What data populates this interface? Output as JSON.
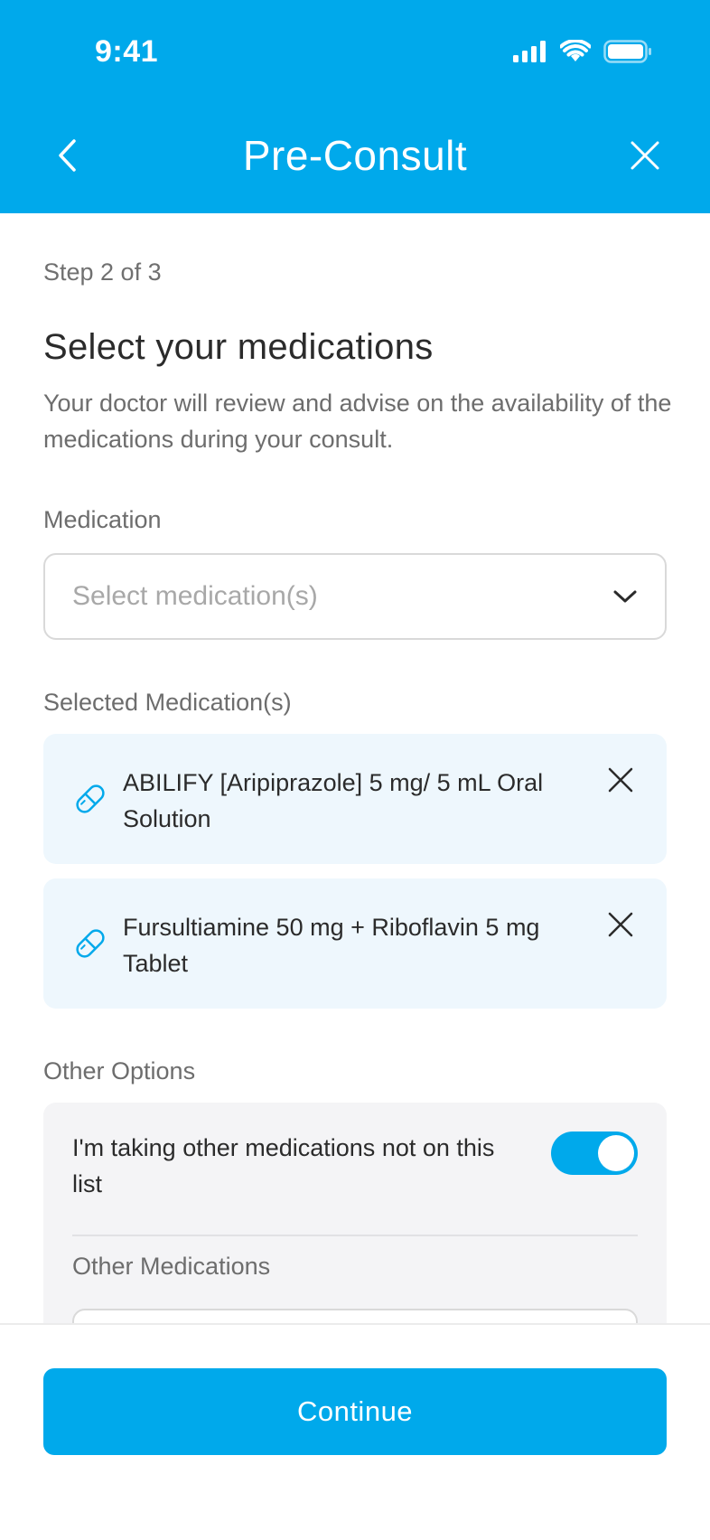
{
  "status_bar": {
    "time": "9:41"
  },
  "header": {
    "title": "Pre-Consult"
  },
  "step": "Step 2 of 3",
  "title": "Select your medications",
  "description": "Your doctor will review and advise on the availability of the medications during your consult.",
  "medication_field": {
    "label": "Medication",
    "placeholder": "Select medication(s)"
  },
  "selected": {
    "label": "Selected Medication(s)",
    "items": [
      {
        "name": "ABILIFY [Aripiprazole] 5 mg/ 5 mL Oral Solution"
      },
      {
        "name": "Fursultiamine 50 mg + Riboflavin 5 mg Tablet"
      }
    ]
  },
  "other_options": {
    "label": "Other Options",
    "toggle_label": "I'm taking other medications not on this list",
    "toggle_on": true,
    "other_medications_label": "Other Medications"
  },
  "footer": {
    "continue_label": "Continue"
  },
  "colors": {
    "brand": "#00a9eb",
    "card_bg": "#eef7fd",
    "panel_bg": "#f4f4f6"
  }
}
